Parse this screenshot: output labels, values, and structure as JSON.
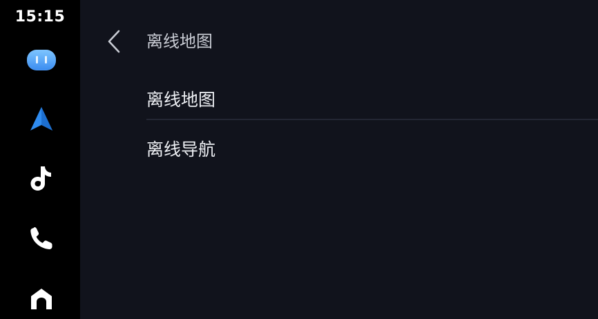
{
  "status": {
    "time": "15:15"
  },
  "dock": {
    "items": [
      {
        "name": "assistant",
        "icon": "assistant-face-icon"
      },
      {
        "name": "navigation",
        "icon": "navigation-arrow-icon",
        "color": "#2f8cf0"
      },
      {
        "name": "music",
        "icon": "music-note-icon"
      },
      {
        "name": "phone",
        "icon": "phone-icon"
      },
      {
        "name": "home",
        "icon": "home-icon"
      }
    ]
  },
  "header": {
    "back_icon": "chevron-left-icon",
    "title": "离线地图"
  },
  "list": {
    "items": [
      {
        "label": "离线地图"
      },
      {
        "label": "离线导航"
      }
    ]
  },
  "colors": {
    "dock_bg": "#000000",
    "main_bg": "#11131c",
    "accent_blue": "#2f8cf0",
    "text_primary": "#eef0f4",
    "text_secondary": "#c9ccd4",
    "divider": "#232633"
  }
}
